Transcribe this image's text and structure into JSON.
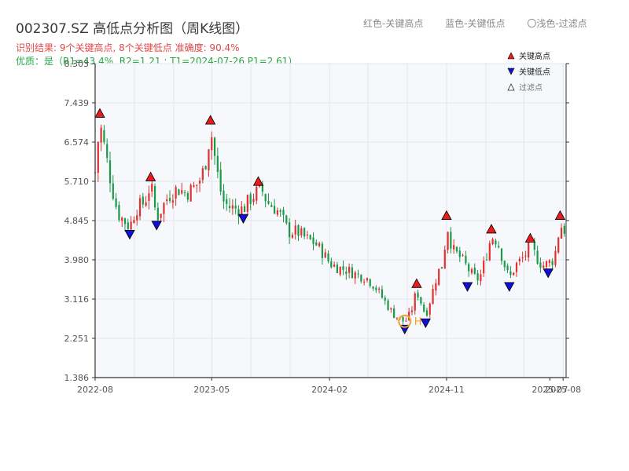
{
  "header": {
    "title": "002307.SZ 高低点分析图（周K线图）",
    "result_line": "识别结果: 9个关键高点, 8个关键低点  准确度: 90.4%",
    "quality_line": "优质：是（R1=43.4%, R2=1.21 ; T1=2024-07-26 P1=2.61）"
  },
  "top_legend": {
    "red_label": "红色-关键高点",
    "blue_label": "蓝色-关键低点",
    "light_label": "〇浅色-过滤点"
  },
  "legend": {
    "high_label": "关键高点",
    "low_label": "关键低点",
    "filtered_label": "过滤点"
  },
  "colors": {
    "up": "#e03030",
    "down": "#1a9a48",
    "high_marker": "#e81c1c",
    "low_marker": "#1010d8",
    "highlight": "#f0a030"
  },
  "chart_data": {
    "type": "candlestick",
    "title": "002307.SZ 高低点分析图（周K线图）",
    "y_ticks": [
      "1.386",
      "2.251",
      "3.116",
      "3.980",
      "4.845",
      "5.710",
      "6.574",
      "7.439",
      "8.303"
    ],
    "ylim": [
      1.386,
      8.303
    ],
    "x_ticks": [
      "2022-08",
      "2023-05",
      "2024-02",
      "2024-11",
      "2025-08",
      "2025-07"
    ],
    "x_tick_dates": [
      "2022-08-01",
      "2023-05-01",
      "2024-02-01",
      "2024-11-01",
      "2025-08-01",
      "2025-07-01"
    ],
    "xlim": [
      "2022-08-01",
      "2025-08-08"
    ],
    "grid": true,
    "legend_position": "top-right",
    "price_path": [
      [
        "2022-08-01",
        5.9
      ],
      [
        "2022-08-12",
        7.0
      ],
      [
        "2022-08-26",
        6.3
      ],
      [
        "2022-09-09",
        5.6
      ],
      [
        "2022-09-23",
        5.0
      ],
      [
        "2022-10-07",
        4.85
      ],
      [
        "2022-10-21",
        4.7
      ],
      [
        "2022-11-04",
        5.1
      ],
      [
        "2022-11-25",
        5.25
      ],
      [
        "2022-12-09",
        5.65
      ],
      [
        "2022-12-23",
        4.9
      ],
      [
        "2023-01-06",
        5.15
      ],
      [
        "2023-01-20",
        5.4
      ],
      [
        "2023-02-10",
        5.55
      ],
      [
        "2023-03-03",
        5.45
      ],
      [
        "2023-03-24",
        5.6
      ],
      [
        "2023-04-07",
        5.8
      ],
      [
        "2023-04-21",
        6.3
      ],
      [
        "2023-04-28",
        6.9
      ],
      [
        "2023-05-12",
        6.0
      ],
      [
        "2023-05-26",
        5.3
      ],
      [
        "2023-06-09",
        5.15
      ],
      [
        "2023-06-30",
        5.1
      ],
      [
        "2023-07-14",
        5.1
      ],
      [
        "2023-07-28",
        5.3
      ],
      [
        "2023-08-18",
        5.5
      ],
      [
        "2023-08-25",
        5.55
      ],
      [
        "2023-09-08",
        5.25
      ],
      [
        "2023-09-29",
        5.1
      ],
      [
        "2023-10-13",
        4.9
      ],
      [
        "2023-10-27",
        4.6
      ],
      [
        "2023-11-17",
        4.6
      ],
      [
        "2023-12-08",
        4.45
      ],
      [
        "2023-12-29",
        4.35
      ],
      [
        "2024-01-19",
        4.1
      ],
      [
        "2024-02-02",
        3.9
      ],
      [
        "2024-02-23",
        3.8
      ],
      [
        "2024-03-15",
        3.75
      ],
      [
        "2024-04-05",
        3.65
      ],
      [
        "2024-04-26",
        3.6
      ],
      [
        "2024-05-17",
        3.4
      ],
      [
        "2024-06-07",
        3.1
      ],
      [
        "2024-06-28",
        2.8
      ],
      [
        "2024-07-12",
        2.7
      ],
      [
        "2024-07-26",
        2.61
      ],
      [
        "2024-08-09",
        2.8
      ],
      [
        "2024-08-23",
        3.3
      ],
      [
        "2024-09-06",
        2.95
      ],
      [
        "2024-09-13",
        2.75
      ],
      [
        "2024-09-27",
        3.2
      ],
      [
        "2024-10-11",
        3.7
      ],
      [
        "2024-10-25",
        3.9
      ],
      [
        "2024-11-01",
        4.8
      ],
      [
        "2024-11-15",
        4.2
      ],
      [
        "2024-12-06",
        4.0
      ],
      [
        "2024-12-20",
        3.8
      ],
      [
        "2025-01-03",
        3.6
      ],
      [
        "2025-01-17",
        3.55
      ],
      [
        "2025-01-31",
        4.0
      ],
      [
        "2025-02-14",
        4.5
      ],
      [
        "2025-02-28",
        4.4
      ],
      [
        "2025-03-14",
        3.95
      ],
      [
        "2025-03-28",
        3.55
      ],
      [
        "2025-04-11",
        3.85
      ],
      [
        "2025-05-02",
        4.05
      ],
      [
        "2025-05-16",
        4.3
      ],
      [
        "2025-05-30",
        4.05
      ],
      [
        "2025-06-13",
        3.85
      ],
      [
        "2025-06-27",
        3.9
      ],
      [
        "2025-07-11",
        4.0
      ],
      [
        "2025-07-25",
        4.75
      ],
      [
        "2025-08-08",
        4.6
      ]
    ],
    "key_highs": [
      {
        "date": "2022-08-12",
        "price": 7.05
      },
      {
        "date": "2022-12-09",
        "price": 5.65
      },
      {
        "date": "2023-04-28",
        "price": 6.9
      },
      {
        "date": "2023-08-18",
        "price": 5.55
      },
      {
        "date": "2024-08-23",
        "price": 3.3
      },
      {
        "date": "2024-11-01",
        "price": 4.8
      },
      {
        "date": "2025-02-14",
        "price": 4.5
      },
      {
        "date": "2025-05-16",
        "price": 4.3
      },
      {
        "date": "2025-07-25",
        "price": 4.8
      }
    ],
    "key_lows": [
      {
        "date": "2022-10-21",
        "price": 4.7
      },
      {
        "date": "2022-12-23",
        "price": 4.9
      },
      {
        "date": "2023-07-14",
        "price": 5.05
      },
      {
        "date": "2024-07-26",
        "price": 2.61
      },
      {
        "date": "2024-09-13",
        "price": 2.75
      },
      {
        "date": "2024-12-20",
        "price": 3.55
      },
      {
        "date": "2025-03-28",
        "price": 3.55
      },
      {
        "date": "2025-06-27",
        "price": 3.85
      }
    ],
    "highlight_point": {
      "date": "2024-07-26",
      "price": 2.61,
      "label": "H"
    }
  }
}
